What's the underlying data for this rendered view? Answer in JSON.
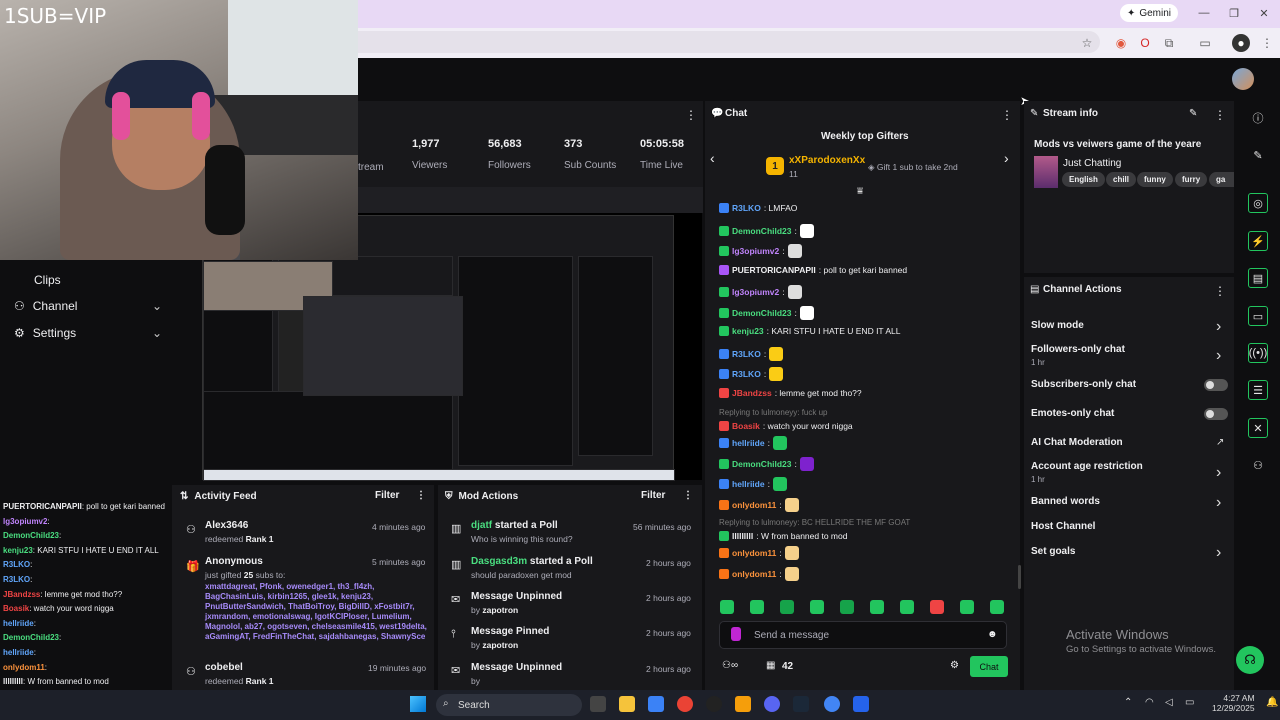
{
  "overlay": {
    "sub_vip": "1SUB=VIP"
  },
  "browser": {
    "gemini_label": "Gemini"
  },
  "nav": [
    {
      "label": "Clips"
    },
    {
      "label": "Channel"
    },
    {
      "label": "Settings"
    }
  ],
  "stats": {
    "partial_label": "tream",
    "items": [
      {
        "value": "1,977",
        "label": "Viewers"
      },
      {
        "value": "56,683",
        "label": "Followers"
      },
      {
        "value": "373",
        "label": "Sub Counts"
      },
      {
        "value": "05:05:58",
        "label": "Time Live"
      }
    ]
  },
  "left_chat": [
    {
      "user": "PUERTORICANPAPII",
      "color": "#efeff1",
      "text": ": poll to get kari banned"
    },
    {
      "user": "lg3opiumv2",
      "color": "#c084fc",
      "text": ":"
    },
    {
      "user": "DemonChild23",
      "color": "#4ade80",
      "text": ":"
    },
    {
      "user": "kenju23",
      "color": "#4ade80",
      "text": ": KARI STFU I HATE U END IT ALL"
    },
    {
      "user": "R3LKO",
      "color": "#60a5fa",
      "text": ":"
    },
    {
      "user": "R3LKO",
      "color": "#60a5fa",
      "text": ":"
    },
    {
      "user": "JBandzss",
      "color": "#ef4444",
      "text": ": lemme get mod tho??"
    },
    {
      "user": "Boasik",
      "color": "#ef4444",
      "text": ": watch your word nigga"
    },
    {
      "user": "hellriide",
      "color": "#60a5fa",
      "text": ":"
    },
    {
      "user": "DemonChild23",
      "color": "#4ade80",
      "text": ":"
    },
    {
      "user": "hellriide",
      "color": "#60a5fa",
      "text": ":"
    },
    {
      "user": "onlydom11",
      "color": "#fb923c",
      "text": ":"
    },
    {
      "user": "lllllllll",
      "color": "#efeff1",
      "text": ": W from banned to mod"
    },
    {
      "user": "onlydom11",
      "color": "#fb923c",
      "text": ":"
    }
  ],
  "activity_feed": {
    "title": "Activity Feed",
    "filter": "Filter",
    "items": [
      {
        "name": "Alex3646",
        "time": "4 minutes ago",
        "sub_prefix": "redeemed",
        "sub_bold": "Rank 1"
      },
      {
        "name": "Anonymous",
        "time": "5 minutes ago",
        "sub_prefix": "just gifted",
        "sub_bold": "25",
        "sub_suffix": "subs to:",
        "recipients": "xmattdagreat, Pfonk, owenedger1, th3_fl4zh, BagChasinLuis, kirbin1265, glee1k, kenju23, PnutButterSandwich, ThatBoiTroy, BigDillD, xFostbit7r, jxmrandom, emotionalswag, IgotKCIPloser, Lumelium, Magnolol, ab27, ogotseven, chelseasmile415, west19delta, aGamingAT, FredFinTheChat, sajdahbanegas, ShawnySce"
      },
      {
        "name": "cobebel",
        "time": "19 minutes ago",
        "sub_prefix": "redeemed",
        "sub_bold": "Rank 1"
      }
    ]
  },
  "mod_actions": {
    "title": "Mod Actions",
    "filter": "Filter",
    "items": [
      {
        "user": "djatf",
        "action": "started a Poll",
        "time": "56 minutes ago",
        "detail": "Who is winning this round?"
      },
      {
        "user": "Dasgasd3m",
        "action": "started a Poll",
        "time": "2 hours ago",
        "detail": "should paradoxen get mod"
      },
      {
        "user": "",
        "action": "Message Unpinned",
        "time": "2 hours ago",
        "detail_prefix": "by",
        "detail": "zapotron"
      },
      {
        "user": "",
        "action": "Message Pinned",
        "time": "2 hours ago",
        "detail_prefix": "by",
        "detail": "zapotron"
      },
      {
        "user": "",
        "action": "Message Unpinned",
        "time": "2 hours ago",
        "detail_prefix": "by",
        "detail": ""
      }
    ]
  },
  "chat": {
    "title": "Chat",
    "gifters_title": "Weekly top Gifters",
    "top_gifter": {
      "name": "xXParodoxenXx",
      "count": "11",
      "rank": "1"
    },
    "gift_hint": "Gift 1 sub to take 2nd",
    "messages": [
      {
        "user": "R3LKO",
        "color": "#60a5fa",
        "text": ": LMFAO"
      },
      {
        "user": "DemonChild23",
        "color": "#4ade80",
        "text": ":"
      },
      {
        "user": "lg3opiumv2",
        "color": "#c084fc",
        "text": ":"
      },
      {
        "user": "PUERTORICANPAPII",
        "color": "#efeff1",
        "text": ": poll to get kari banned"
      },
      {
        "user": "lg3opiumv2",
        "color": "#c084fc",
        "text": ":"
      },
      {
        "user": "DemonChild23",
        "color": "#4ade80",
        "text": ":"
      },
      {
        "user": "kenju23",
        "color": "#4ade80",
        "text": ": KARI STFU I HATE U END IT ALL"
      },
      {
        "user": "R3LKO",
        "color": "#60a5fa",
        "text": ":"
      },
      {
        "user": "R3LKO",
        "color": "#60a5fa",
        "text": ":"
      },
      {
        "user": "JBandzss",
        "color": "#ef4444",
        "text": ": lemme get mod tho??"
      },
      {
        "reply": "Replying to lulmoneyy: fuck up",
        "user": "Boasik",
        "color": "#ef4444",
        "text": ": watch your word nigga"
      },
      {
        "user": "hellriide",
        "color": "#60a5fa",
        "text": ":"
      },
      {
        "user": "DemonChild23",
        "color": "#4ade80",
        "text": ":"
      },
      {
        "user": "hellriide",
        "color": "#60a5fa",
        "text": ":"
      },
      {
        "user": "onlydom11",
        "color": "#fb923c",
        "text": ":"
      },
      {
        "reply": "Replying to lulmoneyy: BC HELLRIDE THE MF GOAT",
        "user": "lllllllll",
        "color": "#efeff1",
        "text": ": W from banned to mod"
      },
      {
        "user": "onlydom11",
        "color": "#fb923c",
        "text": ":"
      },
      {
        "user": "onlydom11",
        "color": "#fb923c",
        "text": ":"
      }
    ],
    "input_placeholder": "Send a message",
    "points": "42",
    "send_label": "Chat"
  },
  "stream_info": {
    "title": "Stream info",
    "stream_title": "Mods vs veiwers game of the yeare",
    "category": "Just Chatting",
    "tags": [
      "English",
      "chill",
      "funny",
      "furry",
      "ga"
    ]
  },
  "channel_actions": {
    "title": "Channel Actions",
    "items": [
      {
        "label": "Slow mode",
        "control": "chevron"
      },
      {
        "label": "Followers-only chat",
        "sub": "1 hr",
        "control": "chevron"
      },
      {
        "label": "Subscribers-only chat",
        "control": "toggle"
      },
      {
        "label": "Emotes-only chat",
        "control": "toggle"
      },
      {
        "label": "AI Chat Moderation",
        "control": "external"
      },
      {
        "label": "Account age restriction",
        "sub": "1 hr",
        "control": "chevron"
      },
      {
        "label": "Banned words",
        "control": "chevron"
      },
      {
        "label": "Host Channel",
        "control": "none"
      },
      {
        "label": "Set goals",
        "control": "chevron"
      }
    ]
  },
  "activate_windows": {
    "title": "Activate Windows",
    "subtitle": "Go to Settings to activate Windows."
  },
  "taskbar": {
    "search": "Search",
    "time": "4:27 AM",
    "date": "12/29/2025"
  },
  "colors": {
    "accent": "#22c55e",
    "panel": "#18181b",
    "bg": "#0e0e10"
  }
}
